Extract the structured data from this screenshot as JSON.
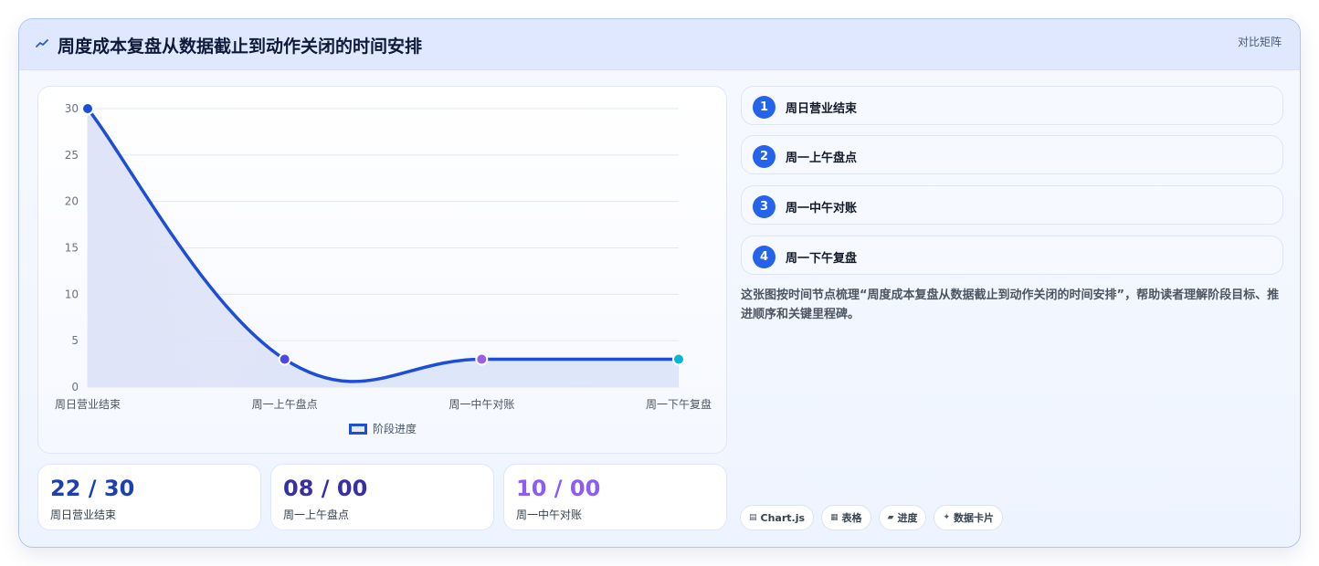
{
  "header": {
    "title": "周度成本复盘从数据截止到动作关闭的时间安排",
    "icon": "trend-icon",
    "action": "对比矩阵"
  },
  "chart_data": {
    "type": "line",
    "categories": [
      "周日营业结束",
      "周一上午盘点",
      "周一中午对账",
      "周一下午复盘"
    ],
    "series": [
      {
        "name": "阶段进度",
        "values": [
          30,
          3,
          3,
          3
        ],
        "color": "#1d4ed8",
        "point_colors": [
          "#1d4ed8",
          "#4f46e5",
          "#9b5de5",
          "#06b6d4"
        ]
      }
    ],
    "y_ticks": [
      "0",
      "5",
      "10",
      "15",
      "20",
      "25",
      "30"
    ],
    "ylim": [
      0,
      30
    ],
    "grid": true,
    "legend": "bottom",
    "smooth": true,
    "fill": true
  },
  "stats": [
    {
      "value": "22 / 30",
      "label": "周日营业结束",
      "color": "#1e40af"
    },
    {
      "value": "08 / 00",
      "label": "周一上午盘点",
      "color": "#3730a3"
    },
    {
      "value": "10 / 00",
      "label": "周一中午对账",
      "color": "#8b5cf6"
    }
  ],
  "steps": [
    {
      "num": "1",
      "label": "周日营业结束"
    },
    {
      "num": "2",
      "label": "周一上午盘点"
    },
    {
      "num": "3",
      "label": "周一中午对账"
    },
    {
      "num": "4",
      "label": "周一下午复盘"
    }
  ],
  "description": "这张图按时间节点梳理“周度成本复盘从数据截止到动作关闭的时间安排”，帮助读者理解阶段目标、推进顺序和关键里程碑。",
  "tags": [
    {
      "icon": "▤",
      "label": "Chart.js"
    },
    {
      "icon": "▦",
      "label": "表格"
    },
    {
      "icon": "▰",
      "label": "进度"
    },
    {
      "icon": "✦",
      "label": "数据卡片"
    }
  ]
}
